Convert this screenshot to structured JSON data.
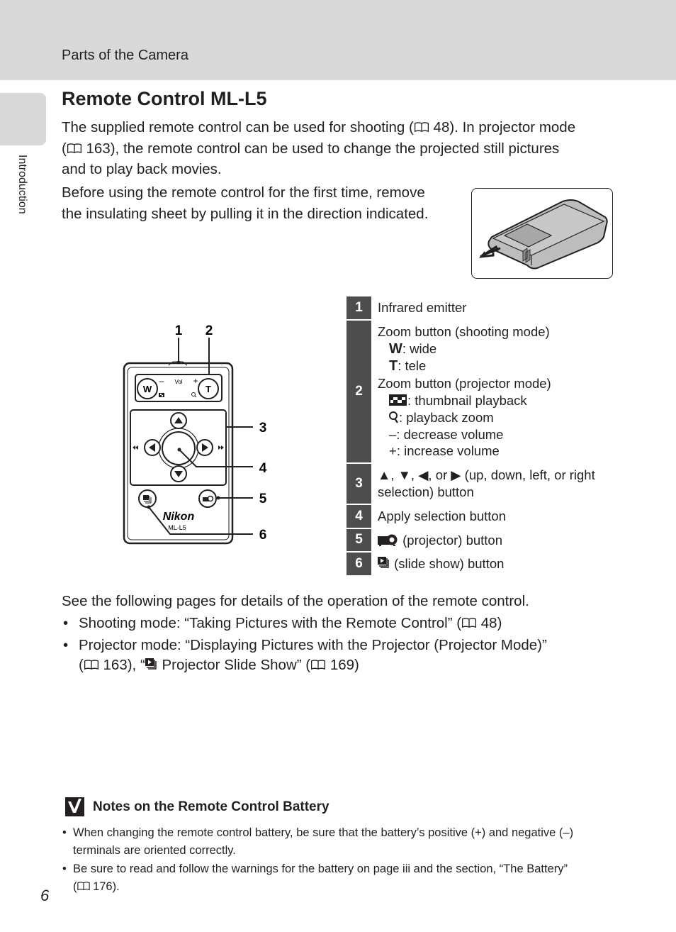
{
  "header": {
    "section": "Parts of the Camera"
  },
  "side_tab": {
    "label": "Introduction"
  },
  "title": "Remote Control ML-L5",
  "intro": {
    "line1_a": "The supplied remote control can be used for shooting (",
    "line1_b": " 48). In projector mode",
    "line2_a": "(",
    "line2_b": " 163), the remote control can be used to change the projected still pictures",
    "line3": "and to play back movies.",
    "line4": "Before using the remote control for the first time, remove",
    "line5": "the insulating sheet by pulling it in the direction indicated."
  },
  "diagram": {
    "callouts": [
      "1",
      "2",
      "3",
      "4",
      "5",
      "6"
    ],
    "labels": {
      "w": "W",
      "t": "T",
      "vol": "Vol",
      "minus": "–",
      "plus": "+",
      "brand": "Nikon",
      "model": "ML-L5"
    }
  },
  "legend": [
    {
      "num": "1",
      "lines": [
        "Infrared emitter"
      ]
    },
    {
      "num": "2",
      "lines": [
        "Zoom button (shooting mode)"
      ],
      "sub1": [
        {
          "key": "W",
          "text": ": wide"
        },
        {
          "key": "T",
          "text": ": tele"
        }
      ],
      "line2": "Zoom button (projector mode)",
      "sub2": [
        {
          "icon": "thumbnail-icon",
          "text": ": thumbnail playback"
        },
        {
          "icon": "zoom-icon",
          "text": ": playback zoom"
        },
        {
          "key": "–",
          "text": ": decrease volume"
        },
        {
          "key": "+",
          "text": ": increase volume"
        }
      ]
    },
    {
      "num": "3",
      "text": ", , , or  (up, down, left, or right selection) button",
      "parts": [
        "▲",
        ", ",
        "▼",
        ", ",
        "◀",
        ", or ",
        "▶",
        " (up, down, left, or right",
        "selection) button"
      ]
    },
    {
      "num": "4",
      "lines": [
        "Apply selection button"
      ]
    },
    {
      "num": "5",
      "text": " (projector) button"
    },
    {
      "num": "6",
      "text": " (slide show) button"
    }
  ],
  "details": {
    "intro": "See the following pages for details of the operation of the remote control.",
    "bullets": [
      {
        "a": "Shooting mode: “Taking Pictures with the Remote Control” (",
        "b": " 48)"
      },
      {
        "a": "Projector mode: “Displaying Pictures with the Projector (Projector Mode)”",
        "b": "(",
        "c": " 163), “",
        "d": " Projector Slide Show” (",
        "e": " 169)"
      }
    ]
  },
  "note": {
    "title": "Notes on the Remote Control Battery",
    "bullets": [
      {
        "a": "When changing the remote control battery, be sure that the battery’s positive (+) and negative (–)",
        "b": "terminals are oriented correctly."
      },
      {
        "a": "Be sure to read and follow the warnings for the battery on page iii and the section, “The Battery”",
        "b": "(",
        "c": " 176)."
      }
    ]
  },
  "page_number": "6",
  "bullet_char": "•"
}
